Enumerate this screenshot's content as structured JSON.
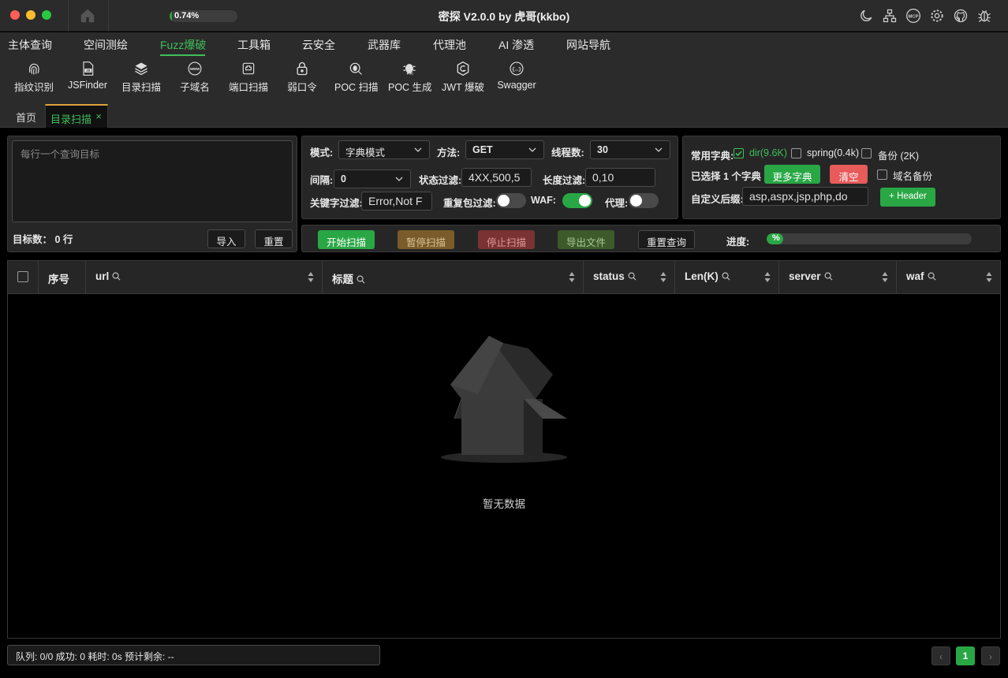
{
  "app": {
    "title": "密探 V2.0.0 by 虎哥(kkbo)",
    "mini_progress_label": "0.74%",
    "mini_progress_value": 0.74
  },
  "menu": [
    {
      "label": "主体查询"
    },
    {
      "label": "空间测绘"
    },
    {
      "label": "Fuzz爆破",
      "active": true
    },
    {
      "label": "工具箱"
    },
    {
      "label": "云安全"
    },
    {
      "label": "武器库"
    },
    {
      "label": "代理池"
    },
    {
      "label": "AI 渗透"
    },
    {
      "label": "网站导航"
    }
  ],
  "tools": [
    {
      "label": "指纹识别",
      "icon": "fingerprint-icon"
    },
    {
      "label": "JSFinder",
      "icon": "js-file-icon"
    },
    {
      "label": "目录扫描",
      "icon": "layers-icon"
    },
    {
      "label": "子域名",
      "icon": "www-icon"
    },
    {
      "label": "端口扫描",
      "icon": "port-icon"
    },
    {
      "label": "弱口令",
      "icon": "lock-icon"
    },
    {
      "label": "POC 扫描",
      "icon": "bug-scan-icon"
    },
    {
      "label": "POC 生成",
      "icon": "bug-gen-icon"
    },
    {
      "label": "JWT 爆破",
      "icon": "jwt-icon"
    },
    {
      "label": "Swagger",
      "icon": "swagger-icon"
    }
  ],
  "tabs": {
    "home": "首页",
    "active": "目录扫描",
    "close": "×"
  },
  "targets": {
    "placeholder": "每行一个查询目标",
    "count_label": "目标数：",
    "count_value": "0 行",
    "import_button": "导入",
    "reset_button": "重置"
  },
  "config": {
    "mode_label": "模式:",
    "mode_value": "字典模式",
    "method_label": "方法:",
    "method_value": "GET",
    "threads_label": "线程数:",
    "threads_value": "30",
    "interval_label": "间隔:",
    "interval_value": "0",
    "status_filter_label": "状态过滤:",
    "status_filter_value": "4XX,500,5",
    "length_filter_label": "长度过滤:",
    "length_filter_value": "0,10",
    "keyword_filter_label": "关键字过滤:",
    "keyword_filter_value": "Error,Not F",
    "dup_filter_label": "重复包过滤:",
    "dup_filter_on": false,
    "waf_label": "WAF:",
    "waf_on": true,
    "proxy_label": "代理:",
    "proxy_on": false
  },
  "dict": {
    "common_label": "常用字典:",
    "options": [
      {
        "label": "dir(9.6K)",
        "checked": true
      },
      {
        "label": "spring(0.4k)",
        "checked": false
      },
      {
        "label": "备份 (2K)",
        "checked": false
      }
    ],
    "selected_text": "已选择 1 个字典",
    "more_button": "更多字典",
    "clear_button": "清空",
    "domain_backup_label": "域名备份",
    "domain_backup_checked": false,
    "suffix_label": "自定义后缀:",
    "suffix_value": "asp,aspx,jsp,php,do",
    "header_button": "+ Header"
  },
  "actions": {
    "start": "开始扫描",
    "pause": "暂停扫描",
    "stop": "停止扫描",
    "export": "导出文件",
    "reset_query": "重置查询",
    "progress_label": "进度:",
    "progress_text": "%",
    "progress_value": 0
  },
  "table": {
    "columns": [
      "序号",
      "url",
      "标题",
      "status",
      "Len(K)",
      "server",
      "waf"
    ],
    "empty_text": "暂无数据"
  },
  "status": {
    "text": "队列: 0/0 成功: 0 耗时: 0s 预计剩余: --"
  },
  "pagination": {
    "current": "1",
    "prev": "‹",
    "next": "›"
  },
  "colors": {
    "accent": "#3fbf5a",
    "danger": "#e85b5b",
    "bg": "#000000",
    "panel": "#262626"
  }
}
